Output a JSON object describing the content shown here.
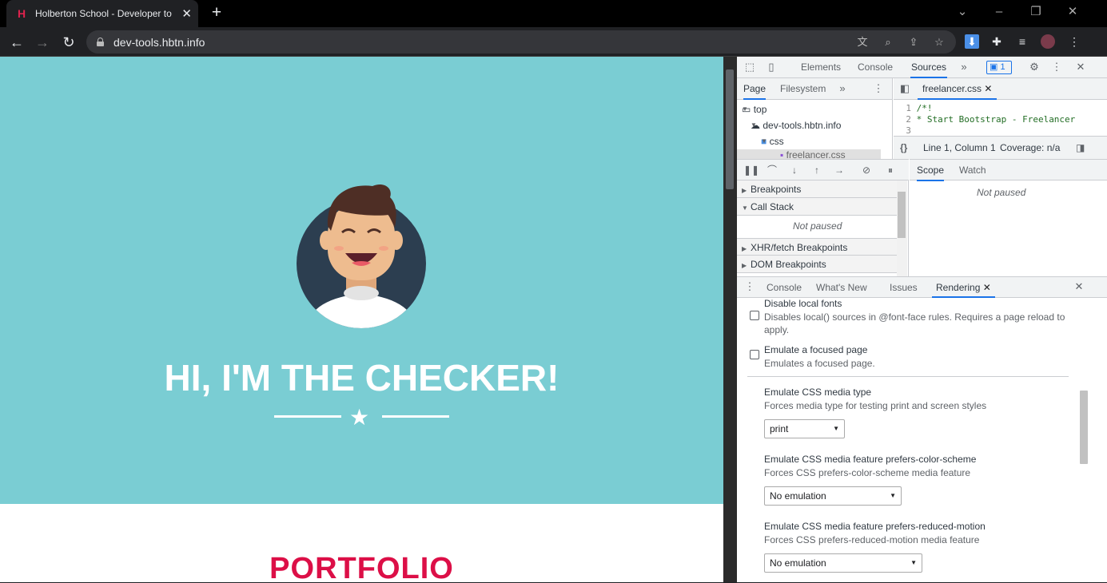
{
  "browser": {
    "tab_title": "Holberton School - Developer to",
    "tab_favicon": "H",
    "url": "dev-tools.hbtn.info"
  },
  "page": {
    "hero_title": "HI, I'M THE CHECKER!",
    "section_title": "PORTFOLIO",
    "colors": {
      "hero_bg": "#7acdd3",
      "accent": "#dc0f47"
    }
  },
  "devtools": {
    "main_tabs": [
      "Elements",
      "Console",
      "Sources"
    ],
    "active_main_tab": "Sources",
    "issues_count": "1",
    "navigator_tabs": [
      "Page",
      "Filesystem"
    ],
    "tree": [
      {
        "label": "top"
      },
      {
        "label": "dev-tools.hbtn.info"
      },
      {
        "label": "css"
      },
      {
        "label": "freelancer.css"
      }
    ],
    "editor": {
      "file_tab": "freelancer.css",
      "lines": [
        {
          "num": "1",
          "text": "/*!"
        },
        {
          "num": "2",
          "text": " * Start Bootstrap - Freelancer"
        },
        {
          "num": "3",
          "text": ""
        }
      ],
      "status_position": "Line 1, Column 1",
      "coverage": "Coverage: n/a"
    },
    "debugger": {
      "sections": [
        {
          "label": "Breakpoints",
          "expanded": false
        },
        {
          "label": "Call Stack",
          "expanded": true
        },
        {
          "label": "XHR/fetch Breakpoints",
          "expanded": false
        },
        {
          "label": "DOM Breakpoints",
          "expanded": false
        }
      ],
      "not_paused": "Not paused",
      "scope_tabs": [
        "Scope",
        "Watch"
      ],
      "scope_message": "Not paused"
    },
    "drawer": {
      "tabs": [
        "Console",
        "What's New",
        "Issues",
        "Rendering"
      ],
      "active_tab": "Rendering",
      "options": [
        {
          "label": "Disable local fonts",
          "desc": "Disables local() sources in @font-face rules. Requires a page reload to apply."
        },
        {
          "label": "Emulate a focused page",
          "desc": "Emulates a focused page."
        }
      ],
      "selects": [
        {
          "label": "Emulate CSS media type",
          "desc": "Forces media type for testing print and screen styles",
          "value": "print"
        },
        {
          "label": "Emulate CSS media feature prefers-color-scheme",
          "desc": "Forces CSS prefers-color-scheme media feature",
          "value": "No emulation"
        },
        {
          "label": "Emulate CSS media feature prefers-reduced-motion",
          "desc": "Forces CSS prefers-reduced-motion media feature",
          "value": "No emulation"
        }
      ]
    }
  }
}
